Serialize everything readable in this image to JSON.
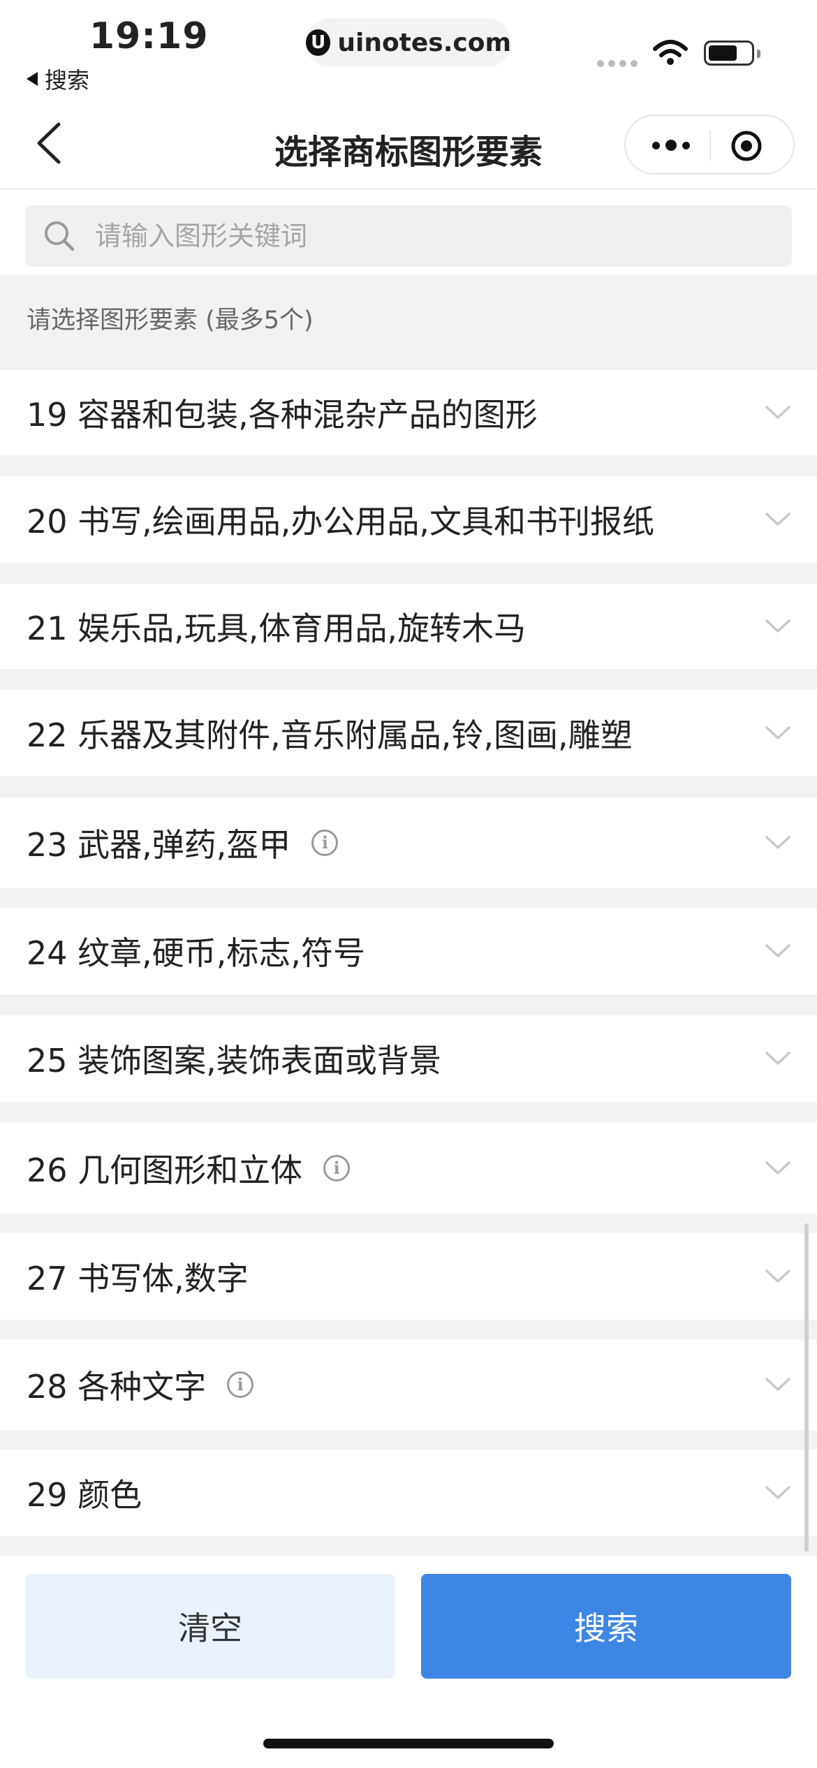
{
  "status_bar": {
    "time": "19:19",
    "back_app": "搜索",
    "url": "uinotes.com"
  },
  "nav": {
    "title": "选择商标图形要素"
  },
  "search": {
    "placeholder": "请输入图形关键词"
  },
  "hint": "请选择图形要素 (最多5个)",
  "items": [
    {
      "label": "19 容器和包装,各种混杂产品的图形",
      "info": false
    },
    {
      "label": "20 书写,绘画用品,办公用品,文具和书刊报纸",
      "info": false
    },
    {
      "label": "21 娱乐品,玩具,体育用品,旋转木马",
      "info": false
    },
    {
      "label": "22 乐器及其附件,音乐附属品,铃,图画,雕塑",
      "info": false
    },
    {
      "label": "23 武器,弹药,盔甲",
      "info": true
    },
    {
      "label": "24 纹章,硬币,标志,符号",
      "info": false
    },
    {
      "label": "25 装饰图案,装饰表面或背景",
      "info": false
    },
    {
      "label": "26 几何图形和立体",
      "info": true
    },
    {
      "label": "27 书写体,数字",
      "info": false
    },
    {
      "label": "28 各种文字",
      "info": true
    },
    {
      "label": "29 颜色",
      "info": false
    }
  ],
  "buttons": {
    "clear": "清空",
    "search": "搜索"
  },
  "colors": {
    "primary": "#3d86e4",
    "secondary_bg": "#eaf3fd"
  }
}
